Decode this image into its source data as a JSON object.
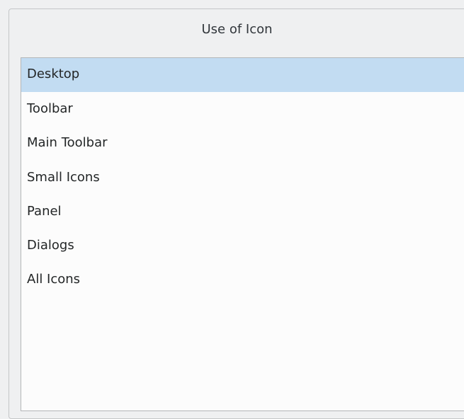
{
  "group": {
    "title": "Use of Icon"
  },
  "list": {
    "items": [
      {
        "label": "Desktop",
        "selected": true
      },
      {
        "label": "Toolbar",
        "selected": false
      },
      {
        "label": "Main Toolbar",
        "selected": false
      },
      {
        "label": "Small Icons",
        "selected": false
      },
      {
        "label": "Panel",
        "selected": false
      },
      {
        "label": "Dialogs",
        "selected": false
      },
      {
        "label": "All Icons",
        "selected": false
      }
    ]
  },
  "colors": {
    "selection": "#c2dcf2",
    "window_bg": "#eff0f1",
    "list_bg": "#fcfcfc"
  }
}
